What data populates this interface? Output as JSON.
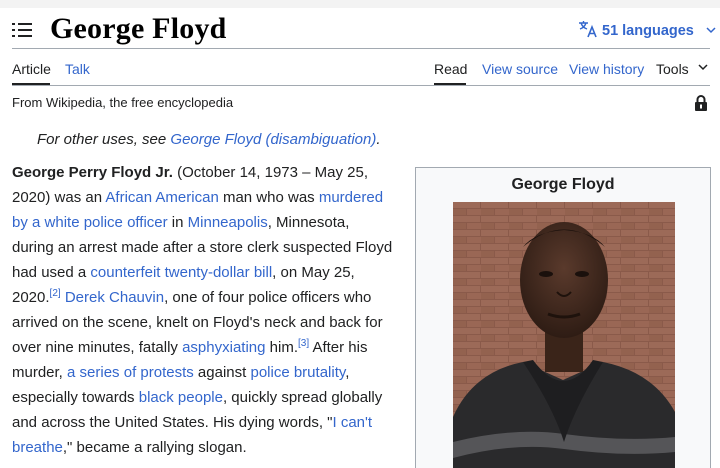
{
  "header": {
    "title": "George Floyd",
    "languages_label": "51 languages",
    "languages_icon": "translate-icon"
  },
  "tabs": {
    "article": "Article",
    "talk": "Talk",
    "read": "Read",
    "view_source": "View source",
    "view_history": "View history",
    "tools": "Tools"
  },
  "tagline": "From Wikipedia, the free encyclopedia",
  "hatnote": {
    "prefix": "For other uses, see ",
    "link": "George Floyd (disambiguation)",
    "suffix": "."
  },
  "lead": {
    "l1_b": "George Perry Floyd Jr.",
    "l1_t": " (October 14, 1973 – May 25,",
    "l2_a": "2020) was an ",
    "l2_link1": "African American",
    "l2_b": " man who was ",
    "l2_link2": "murdered",
    "l3_link": "by a white police officer",
    "l3_a": " in ",
    "l3_link2": "Minneapolis",
    "l3_b": ", Minnesota,",
    "l4": "during an arrest made after a store clerk suspected Floyd",
    "l5_a": "had used a ",
    "l5_link": "counterfeit twenty-dollar bill",
    "l5_b": ", on May 25,",
    "l6_a": "2020.",
    "l6_ref": "[2]",
    "l6_sp": " ",
    "l6_link": "Derek Chauvin",
    "l6_b": ", one of four police officers who",
    "l7": "arrived on the scene, knelt on Floyd's neck and back for",
    "l8_a": "over nine minutes, fatally ",
    "l8_link": "asphyxiating",
    "l8_b": " him.",
    "l8_ref": "[3]",
    "l8_c": " After his",
    "l9_a": "murder, ",
    "l9_link1": "a series of protests",
    "l9_b": " against ",
    "l9_link2": "police brutality",
    "l9_c": ",",
    "l10_a": "especially towards ",
    "l10_link": "black people",
    "l10_b": ", quickly spread globally",
    "l11_a": "and across the United States. His dying words, \"",
    "l11_link": "I can't",
    "l12_link": "breathe",
    "l12_a": ",\" became a rallying slogan."
  },
  "infobox": {
    "title": "George Floyd"
  },
  "colors": {
    "link": "#3366cc",
    "text": "#202122",
    "rule": "#a2a9b1",
    "infobox_bg": "#f8f9fa"
  }
}
